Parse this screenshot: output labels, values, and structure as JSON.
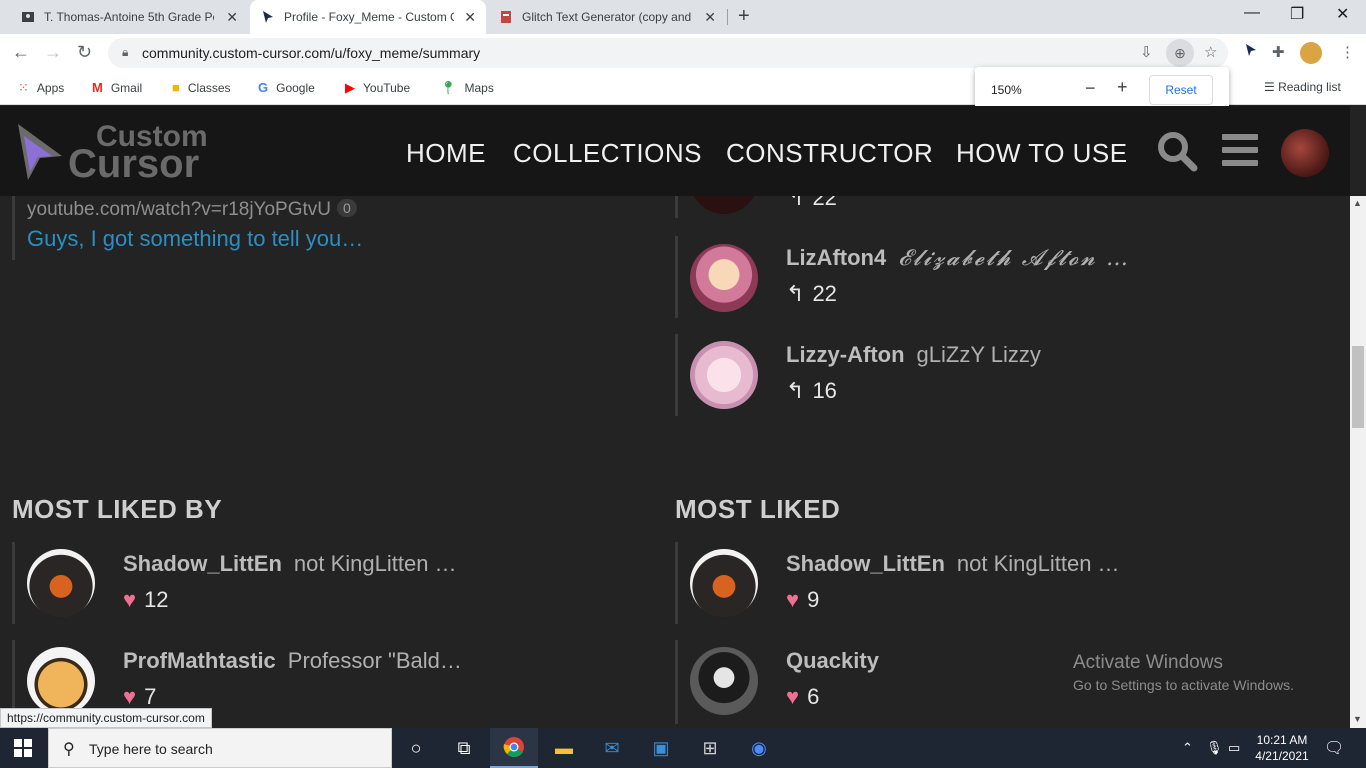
{
  "browser": {
    "tabs": [
      {
        "title": "T. Thomas-Antoine 5th Grade Pe"
      },
      {
        "title": "Profile - Foxy_Meme - Custom Cu"
      },
      {
        "title": "Glitch Text Generator (copy and p"
      }
    ],
    "new_tab": "+",
    "url": "community.custom-cursor.com/u/foxy_meme/summary",
    "bookmarks": [
      {
        "label": "Apps"
      },
      {
        "label": "Gmail"
      },
      {
        "label": "Classes"
      },
      {
        "label": "Google"
      },
      {
        "label": "YouTube"
      },
      {
        "label": "Maps"
      }
    ],
    "reading_list": "Reading list",
    "zoom": {
      "level": "150%",
      "minus": "−",
      "plus": "+",
      "reset": "Reset"
    }
  },
  "site": {
    "logo_line1": "Custom",
    "logo_line2": "Cursor",
    "nav": [
      "HOME",
      "COLLECTIONS",
      "CONSTRUCTOR",
      "HOW TO USE"
    ]
  },
  "top_left": {
    "link_text": "youtube.com/watch?v=r18jYoPGtvU",
    "link_count": "0",
    "topic_title": "Guys, I got something to tell you…"
  },
  "top_right": {
    "partial_row": {
      "count": "22"
    },
    "rows": [
      {
        "username": "LizAfton4",
        "description": "𝓔𝓵𝓲𝔃𝓪𝓫𝓮𝓽𝓱 𝓐𝓯𝓽𝓸𝓷 …",
        "count": "22"
      },
      {
        "username": "Lizzy-Afton",
        "description": "gLiZzY Lizzy",
        "count": "16"
      }
    ]
  },
  "most_liked_by": {
    "title": "MOST LIKED BY",
    "rows": [
      {
        "username": "Shadow_LittEn",
        "description": "not KingLitten …",
        "count": "12"
      },
      {
        "username": "ProfMathtastic",
        "description": "Professor \"Bald…",
        "count": "7"
      }
    ]
  },
  "most_liked": {
    "title": "MOST LIKED",
    "rows": [
      {
        "username": "Shadow_LittEn",
        "description": "not KingLitten …",
        "count": "9"
      },
      {
        "username": "Quackity",
        "description": "",
        "count": "6"
      }
    ]
  },
  "watermark": {
    "line1": "Activate Windows",
    "line2": "Go to Settings to activate Windows."
  },
  "status_url": "https://community.custom-cursor.com",
  "taskbar": {
    "search_placeholder": "Type here to search",
    "time": "10:21 AM",
    "date": "4/21/2021"
  },
  "colors": {
    "page_bg": "#232323",
    "header_bg": "#161616",
    "link_blue": "#2a8fc4",
    "heart": "#f06f95"
  }
}
